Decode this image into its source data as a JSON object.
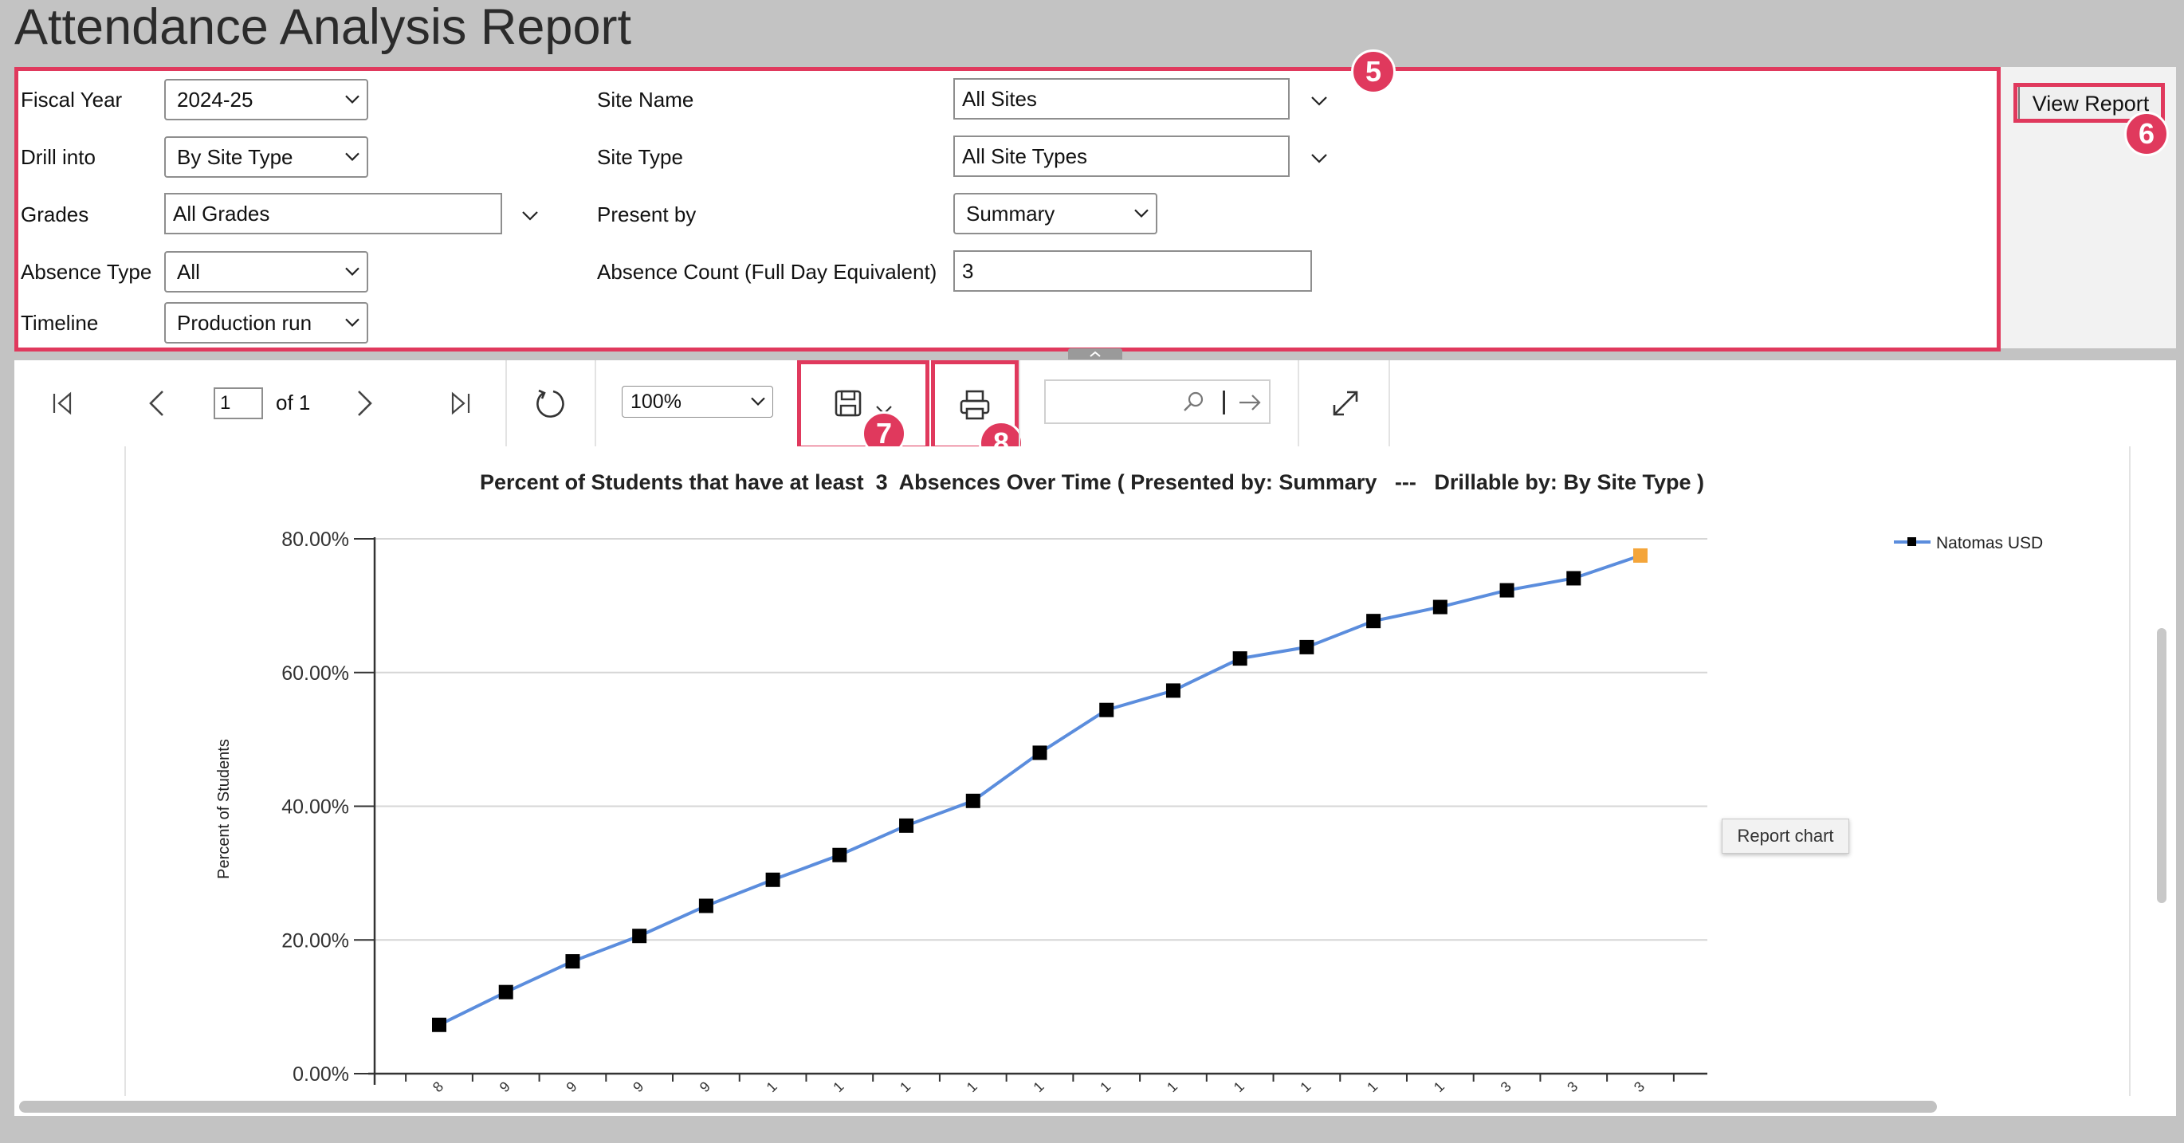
{
  "page_title": "Attendance Analysis Report",
  "parameters": {
    "fiscal_year": {
      "label": "Fiscal Year",
      "value": "2024-25"
    },
    "drill_into": {
      "label": "Drill into",
      "value": "By Site Type"
    },
    "grades": {
      "label": "Grades",
      "value": "All Grades"
    },
    "absence_type": {
      "label": "Absence Type",
      "value": "All"
    },
    "timeline": {
      "label": "Timeline",
      "value": "Production run"
    },
    "site_name": {
      "label": "Site Name",
      "value": "All Sites"
    },
    "site_type": {
      "label": "Site Type",
      "value": "All Site Types"
    },
    "present_by": {
      "label": "Present by",
      "value": "Summary"
    },
    "absence_count": {
      "label": "Absence Count (Full Day Equivalent)",
      "value": "3"
    }
  },
  "view_report_label": "View Report",
  "callouts": {
    "params": "5",
    "view_report": "6",
    "save": "7",
    "print": "8"
  },
  "toolbar": {
    "page_value": "1",
    "page_of": "of 1",
    "zoom_value": "100%",
    "find_placeholder": "",
    "icons": [
      "first-page-icon",
      "prev-page-icon",
      "next-page-icon",
      "last-page-icon",
      "refresh-icon",
      "save-icon",
      "chevron-down-icon",
      "print-icon",
      "search-icon",
      "find-next-icon",
      "fullscreen-icon"
    ]
  },
  "tooltip": "Report chart",
  "colors": {
    "highlight": "#e0395d",
    "series_line": "#5b8ddd",
    "marker": "#000000",
    "last_marker": "#f4a53a"
  },
  "chart_data": {
    "type": "line",
    "title": "Percent of Students that have at least  3  Absences Over Time ( Presented by: Summary   ---   Drillable by: By Site Type )",
    "ylabel": "Percent of Students",
    "xlabel": "",
    "ylim": [
      0,
      80
    ],
    "yticks": [
      "0.00%",
      "20.00%",
      "40.00%",
      "60.00%",
      "80.00%"
    ],
    "x_tick_labels": [
      "8",
      "9",
      "9",
      "9",
      "9",
      "1",
      "1",
      "1",
      "1",
      "1",
      "1",
      "1",
      "1",
      "1",
      "1",
      "1",
      "3",
      "3",
      "3"
    ],
    "grid": true,
    "legend_position": "top-right",
    "series": [
      {
        "name": "Natomas USD",
        "values": [
          7.3,
          12.2,
          16.8,
          20.6,
          25.1,
          29.0,
          32.7,
          37.1,
          40.8,
          48.0,
          54.4,
          57.3,
          62.1,
          63.8,
          67.7,
          69.8,
          72.3,
          74.1,
          77.5
        ]
      }
    ]
  }
}
